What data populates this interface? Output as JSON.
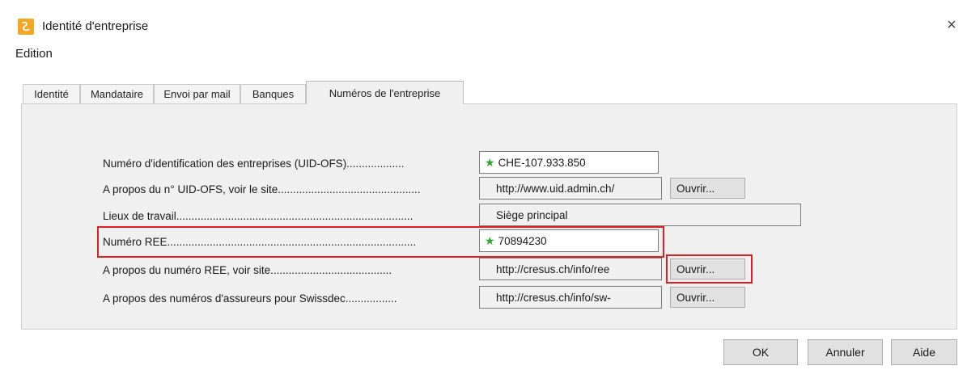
{
  "window": {
    "title": "Identité d'entreprise",
    "app_icon": "cresus-app-icon",
    "close_glyph": "×"
  },
  "menu": {
    "items": [
      "Edition"
    ]
  },
  "tabs": [
    {
      "label": "Identité",
      "active": false
    },
    {
      "label": "Mandataire",
      "active": false
    },
    {
      "label": "Envoi par mail",
      "active": false
    },
    {
      "label": "Banques",
      "active": false
    },
    {
      "label": "Numéros de l'entreprise",
      "active": true
    }
  ],
  "rows": {
    "uid": {
      "label": "Numéro d'identification des entreprises (UID-OFS)...................",
      "value": "CHE-107.933.850"
    },
    "uid_about": {
      "label": "A propos du n° UID-OFS, voir le site...............................................",
      "url": "http://www.uid.admin.ch/",
      "open_label": "Ouvrir..."
    },
    "workplaces": {
      "label": "Lieux de travail..............................................................................",
      "value": "Siège principal"
    },
    "ree": {
      "label": "Numéro REE..................................................................................",
      "value": "70894230"
    },
    "ree_about": {
      "label": "A propos du numéro REE, voir site........................................",
      "url": "http://cresus.ch/info/ree",
      "open_label": "Ouvrir..."
    },
    "swissdec_about": {
      "label": "A propos des numéros d'assureurs pour Swissdec.................",
      "url": "http://cresus.ch/info/sw-",
      "open_label": "Ouvrir..."
    }
  },
  "footer": {
    "ok_label": "OK",
    "cancel_label": "Annuler",
    "help_label": "Aide"
  },
  "colors": {
    "highlight": "#e02020",
    "required_star": "#2fa530",
    "app_icon": "#f5a623"
  }
}
